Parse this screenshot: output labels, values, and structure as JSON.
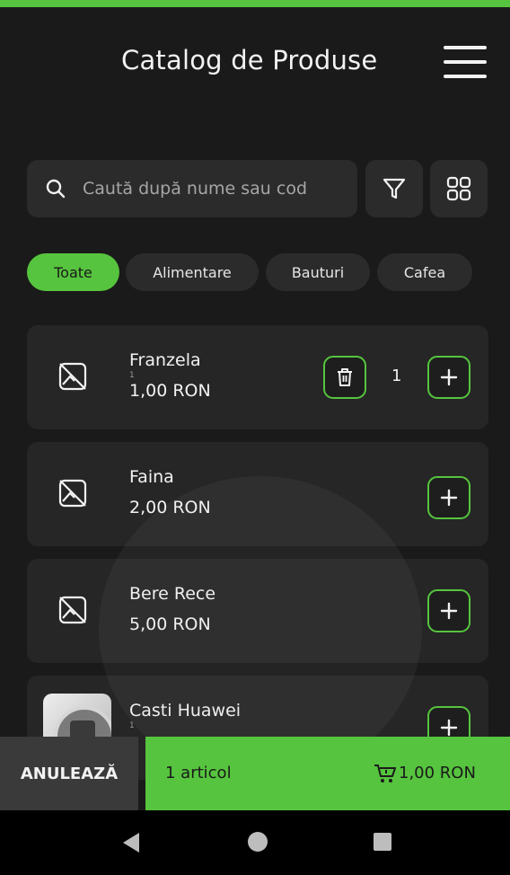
{
  "app": {
    "title": "Catalog de Produse",
    "accent_color": "#56c43e"
  },
  "header": {
    "menu_icon": "hamburger-icon"
  },
  "search": {
    "placeholder": "Caută după nume sau cod",
    "value": ""
  },
  "toolbar": {
    "filter_icon": "filter-icon",
    "grid_icon": "grid-view-icon"
  },
  "categories": [
    {
      "label": "Toate",
      "active": true
    },
    {
      "label": "Alimentare",
      "active": false
    },
    {
      "label": "Bauturi",
      "active": false
    },
    {
      "label": "Cafea",
      "active": false
    }
  ],
  "products": [
    {
      "name": "Franzela",
      "code": "1",
      "price": "1,00 RON",
      "quantity": "1",
      "image": "no-image-icon"
    },
    {
      "name": "Faina",
      "code": "",
      "price": "2,00 RON",
      "image": "no-image-icon"
    },
    {
      "name": "Bere Rece",
      "code": "",
      "price": "5,00 RON",
      "image": "no-image-icon"
    },
    {
      "name": "Casti  Huawei",
      "code": "1",
      "price": "",
      "image": "product-photo"
    }
  ],
  "bottom_bar": {
    "cancel_label": "ANULEAZĂ",
    "items_count": "1 articol",
    "total": "1,00 RON"
  }
}
